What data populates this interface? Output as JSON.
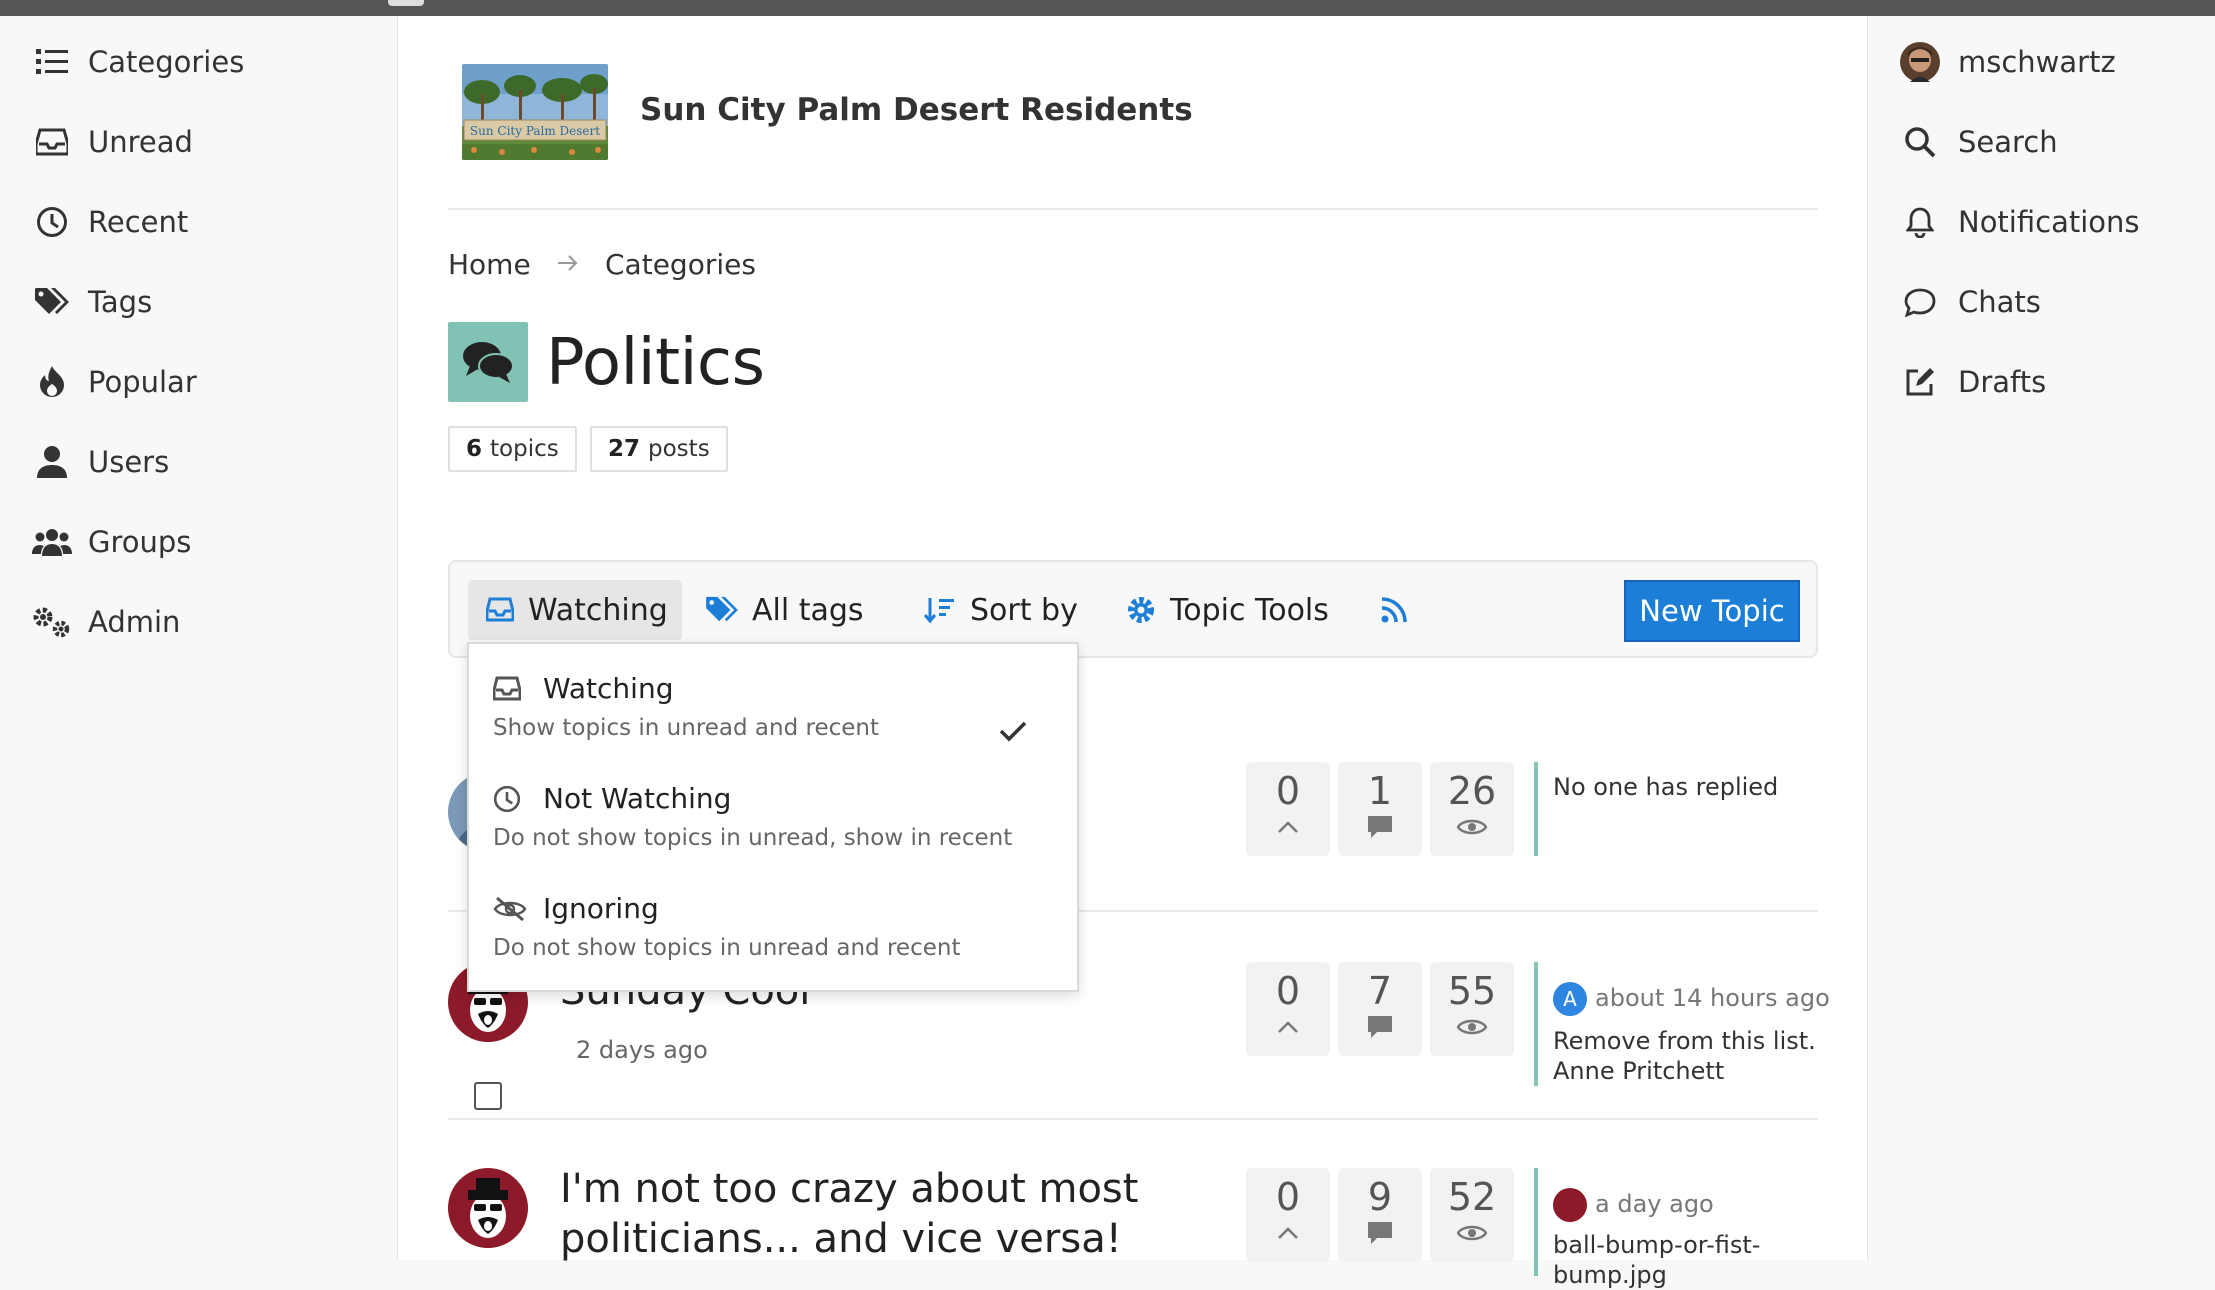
{
  "left_nav": [
    {
      "label": "Categories",
      "icon": "list-icon"
    },
    {
      "label": "Unread",
      "icon": "inbox-icon"
    },
    {
      "label": "Recent",
      "icon": "clock-icon"
    },
    {
      "label": "Tags",
      "icon": "tags-icon"
    },
    {
      "label": "Popular",
      "icon": "fire-icon"
    },
    {
      "label": "Users",
      "icon": "user-icon"
    },
    {
      "label": "Groups",
      "icon": "users-icon"
    },
    {
      "label": "Admin",
      "icon": "cogs-icon"
    }
  ],
  "right_nav": [
    {
      "label": "mschwartz",
      "icon": "avatar"
    },
    {
      "label": "Search",
      "icon": "search-icon"
    },
    {
      "label": "Notifications",
      "icon": "bell-icon"
    },
    {
      "label": "Chats",
      "icon": "chat-icon"
    },
    {
      "label": "Drafts",
      "icon": "edit-icon"
    }
  ],
  "site": {
    "title": "Sun City Palm Desert Residents",
    "logo_text": "Sun City Palm Desert"
  },
  "breadcrumb": {
    "home": "Home",
    "categories": "Categories"
  },
  "category": {
    "title": "Politics",
    "color": "#80c2b3"
  },
  "stats": {
    "topics_count": "6",
    "topics_label": "topics",
    "posts_count": "27",
    "posts_label": "posts"
  },
  "controls": {
    "watching": "Watching",
    "all_tags": "All tags",
    "sort_by": "Sort by",
    "topic_tools": "Topic Tools",
    "new_topic": "New Topic"
  },
  "dropdown": [
    {
      "title": "Watching",
      "desc": "Show topics in unread and recent",
      "selected": true
    },
    {
      "title": "Not Watching",
      "desc": "Do not show topics in unread, show in recent",
      "selected": false
    },
    {
      "title": "Ignoring",
      "desc": "Do not show topics in unread and recent",
      "selected": false
    }
  ],
  "topics": [
    {
      "title": "",
      "meta": "",
      "likes": "0",
      "replies": "1",
      "views": "26",
      "activity_time": "",
      "activity_text": "No one has replied"
    },
    {
      "title": "Sunday Cool",
      "meta": "2 days ago",
      "likes": "0",
      "replies": "7",
      "views": "55",
      "activity_avatar_letter": "A",
      "activity_time": "about 14 hours ago",
      "activity_text": "Remove from this list. Anne Pritchett"
    },
    {
      "title": "I'm not too crazy about most politicians... and vice versa!",
      "meta": "",
      "likes": "0",
      "replies": "9",
      "views": "52",
      "activity_time": "a day ago",
      "activity_text": "ball-bump-or-fist-bump.jpg"
    }
  ],
  "colors": {
    "accent": "#1c7ed6",
    "category": "#80c2b3"
  }
}
